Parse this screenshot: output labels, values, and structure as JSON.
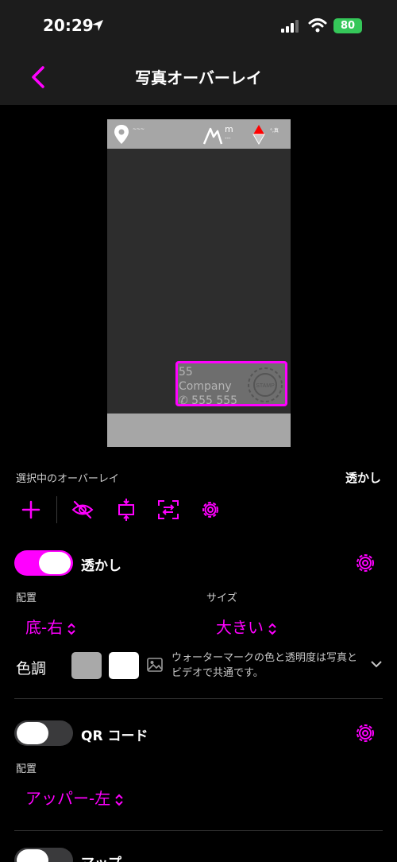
{
  "status": {
    "time": "20:29",
    "battery": "80"
  },
  "nav": {
    "title": "写真オーバーレイ"
  },
  "preview": {
    "altitude_unit": "m",
    "altitude_value": "---",
    "watermark_lines": [
      "55",
      "Company",
      "✆ 555 555"
    ],
    "seal_text": "STAMP"
  },
  "selected_overlay": {
    "label": "選択中のオーバーレイ",
    "value": "透かし"
  },
  "watermark": {
    "title": "透かし",
    "position_label": "配置",
    "position_value": "底-右",
    "size_label": "サイズ",
    "size_value": "大きい",
    "color_label": "色調",
    "swatch_gray": "#a9a9a9",
    "swatch_white": "#ffffff",
    "note": "ウォーターマークの色と透明度は写真とビデオで共通です。"
  },
  "qr": {
    "title": "QR コード",
    "position_label": "配置",
    "position_value": "アッパー-左"
  },
  "map": {
    "title": "マップ"
  },
  "colors": {
    "accent": "#ff00ff",
    "background": "#000000",
    "bar": "#1c1c1c"
  }
}
